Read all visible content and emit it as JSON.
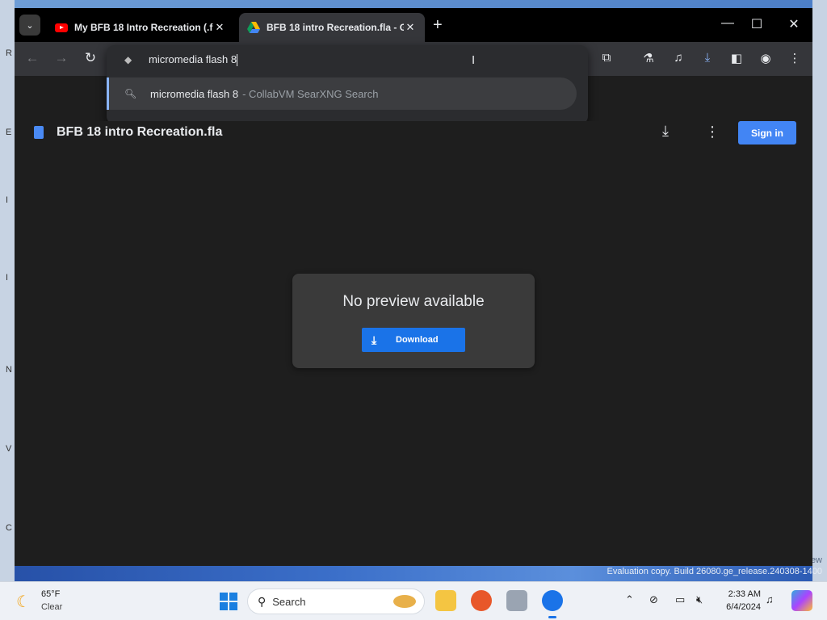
{
  "tabs": [
    {
      "title": "My BFB 18 Intro Recreation (.fl",
      "icon": "youtube-icon"
    },
    {
      "title": "BFB 18 intro Recreation.fla - Go",
      "icon": "google-drive-icon"
    }
  ],
  "omnibox": {
    "value": "micromedia flash 8",
    "suggestion": {
      "query": "micromedia flash 8",
      "source": "- CollabVM SearXNG Search"
    }
  },
  "drive": {
    "file_title": "BFB 18 intro Recreation.fla",
    "sign_in_label": "Sign in",
    "no_preview_text": "No preview available",
    "download_label": "Download"
  },
  "watermark": "Evaluation copy. Build 26080.ge_release.240308-1400",
  "watermark_fragment": "ew",
  "desktop_letters": [
    "R",
    "E",
    "I",
    "I",
    "N",
    "V",
    "C"
  ],
  "taskbar": {
    "weather_temp": "65°F",
    "weather_condition": "Clear",
    "search_label": "Search",
    "clock_time": "2:33 AM",
    "clock_date": "6/4/2024"
  },
  "colors": {
    "accent_blue": "#4285f4",
    "download_blue": "#1a73e8",
    "window_bg": "#1e1e1e"
  }
}
